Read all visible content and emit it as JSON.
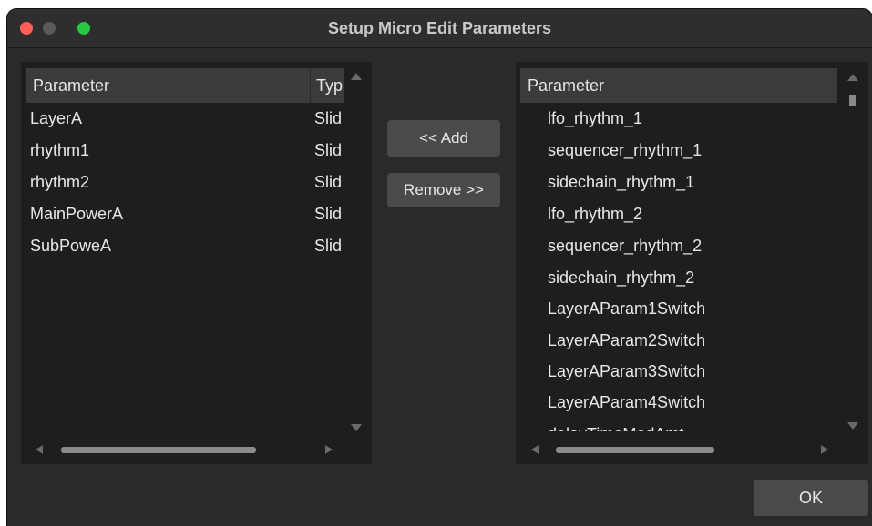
{
  "window": {
    "title": "Setup Micro Edit Parameters"
  },
  "left_list": {
    "columns": [
      "Parameter",
      "Typ"
    ],
    "rows": [
      {
        "name": "LayerA",
        "type": "Slid"
      },
      {
        "name": "rhythm1",
        "type": "Slid"
      },
      {
        "name": "rhythm2",
        "type": "Slid"
      },
      {
        "name": "MainPowerA",
        "type": "Slid"
      },
      {
        "name": "SubPoweA",
        "type": "Slid"
      }
    ]
  },
  "buttons": {
    "add": "<< Add",
    "remove": "Remove >>",
    "ok": "OK"
  },
  "right_list": {
    "columns": [
      "Parameter"
    ],
    "rows": [
      "lfo_rhythm_1",
      "sequencer_rhythm_1",
      "sidechain_rhythm_1",
      "lfo_rhythm_2",
      "sequencer_rhythm_2",
      "sidechain_rhythm_2",
      "LayerAParam1Switch",
      "LayerAParam2Switch",
      "LayerAParam3Switch",
      "LayerAParam4Switch",
      "delayTimeModAmt"
    ]
  },
  "colors": {
    "close": "#ff5f57",
    "minimize": "#5a5a5a",
    "maximize": "#28c840"
  }
}
